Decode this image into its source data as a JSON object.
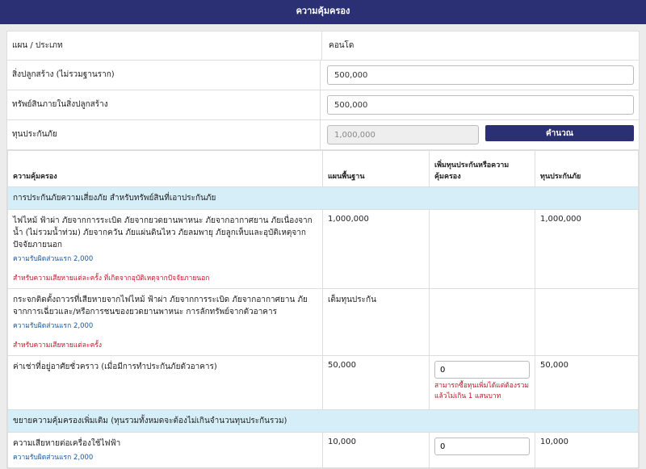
{
  "header": {
    "title": "ความคุ้มครอง"
  },
  "form": {
    "plan_label": "แผน / ประเภท",
    "plan_value": "คอนโด",
    "building_label": "สิ่งปลูกสร้าง (ไม่รวมฐานราก)",
    "building_value": "500,000",
    "property_label": "ทรัพย์สินภายในสิ่งปลูกสร้าง",
    "property_value": "500,000",
    "sum_label": "ทุนประกันภัย",
    "sum_value": "1,000,000",
    "calc_label": "คำนวณ"
  },
  "table": {
    "headers": [
      "ความคุ้มครอง",
      "แผนพื้นฐาน",
      "เพิ่มทุนประกันหรือความคุ้มครอง",
      "ทุนประกันภัย"
    ],
    "section1": "การประกันภัยความเสี่ยงภัย สำหรับทรัพย์สินที่เอาประกันภัย",
    "rows": [
      {
        "title": "ไฟไหม้ ฟ้าผ่า ภัยจากการระเบิด ภัยจากยวดยานพาหนะ ภัยจากอากาศยาน ภัยเนื่องจากน้ำ (ไม่รวมน้ำท่วม) ภัยจากควัน ภัยแผ่นดินไหว ภัยลมพายุ ภัยลูกเห็บและอุบัติเหตุจากปัจจัยภายนอก",
        "deductible": "ความรับผิดส่วนแรก 2,000",
        "note": "สำหรับความเสียหายแต่ละครั้ง ที่เกิดจากอุบัติเหตุจากปัจจัยภายนอก",
        "base": "1,000,000",
        "total": "1,000,000"
      },
      {
        "title": "กระจกติดตั้งถาวรที่เสียหายจากไฟไหม้ ฟ้าผ่า ภัยจากการระเบิด ภัยจากอากาศยาน ภัยจากการเฉี่ยวและ/หรือการชนของยวดยานพาหนะ การลักทรัพย์จากตัวอาคาร",
        "deductible": "ความรับผิดส่วนแรก 2,000",
        "note": "สำหรับความเสียหายแต่ละครั้ง",
        "base": "เต็มทุนประกัน",
        "total": ""
      },
      {
        "title": "ค่าเช่าที่อยู่อาศัยชั่วคราว (เมื่อมีการทำประกันภัยตัวอาคาร)",
        "base": "50,000",
        "extra": "0",
        "extra_note": "สามารถซื้อทุนเพิ่มได้แต่ต้องรวมแล้วไม่เกิน 1 แสนบาท",
        "total": "50,000"
      }
    ],
    "section2": "ขยายความคุ้มครองเพิ่มเติม (ทุนรวมทั้งหมดจะต้องไม่เกินจำนวนทุนประกันรวม)",
    "row4": {
      "title": "ความเสียหายต่อเครื่องใช้ไฟฟ้า",
      "deductible": "ความรับผิดส่วนแรก 2,000",
      "base": "10,000",
      "extra": "0",
      "total": "10,000"
    }
  }
}
